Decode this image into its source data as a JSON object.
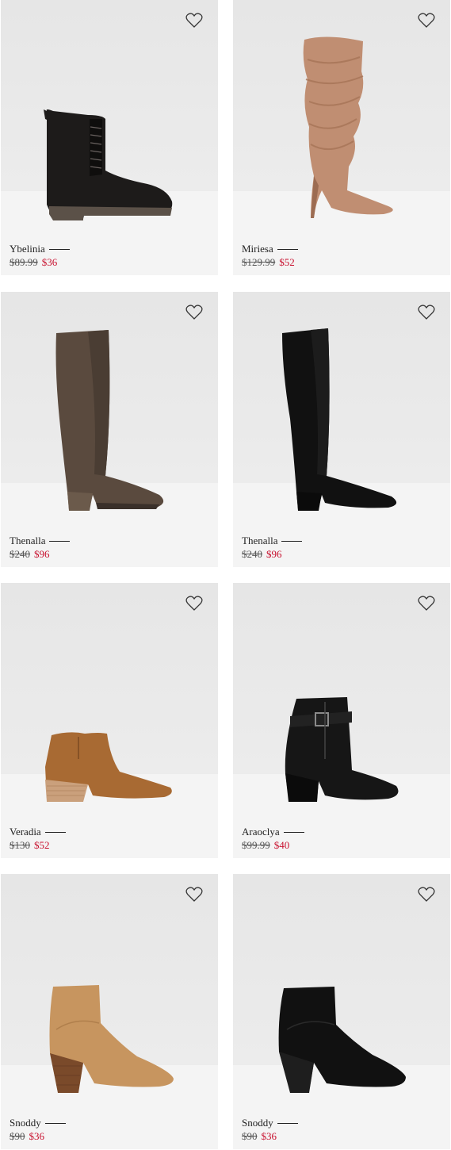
{
  "products": [
    {
      "name": "Ybelinia",
      "old_price": "$89.99",
      "new_price": "$36",
      "icon": "lace-up-combat-boot-icon",
      "color": "#1d1b1a"
    },
    {
      "name": "Miriesa",
      "old_price": "$129.99",
      "new_price": "$52",
      "icon": "slouch-knee-boot-icon",
      "color": "#c08e72"
    },
    {
      "name": "Thenalla",
      "old_price": "$240",
      "new_price": "$96",
      "icon": "knee-high-boot-icon",
      "color": "#5a4a3e"
    },
    {
      "name": "Thenalla",
      "old_price": "$240",
      "new_price": "$96",
      "icon": "knee-high-boot-icon",
      "color": "#111111"
    },
    {
      "name": "Veradia",
      "old_price": "$130",
      "new_price": "$52",
      "icon": "ankle-bootie-icon",
      "color": "#a86a33"
    },
    {
      "name": "Araoclya",
      "old_price": "$99.99",
      "new_price": "$40",
      "icon": "buckle-ankle-boot-icon",
      "color": "#161616"
    },
    {
      "name": "Snoddy",
      "old_price": "$90",
      "new_price": "$36",
      "icon": "heeled-ankle-boot-icon",
      "color": "#c7955f"
    },
    {
      "name": "Snoddy",
      "old_price": "$90",
      "new_price": "$36",
      "icon": "heeled-ankle-boot-icon",
      "color": "#111111"
    }
  ],
  "colors": {
    "sale": "#c8102e",
    "text": "#222222",
    "card_bg": "#ececec"
  }
}
